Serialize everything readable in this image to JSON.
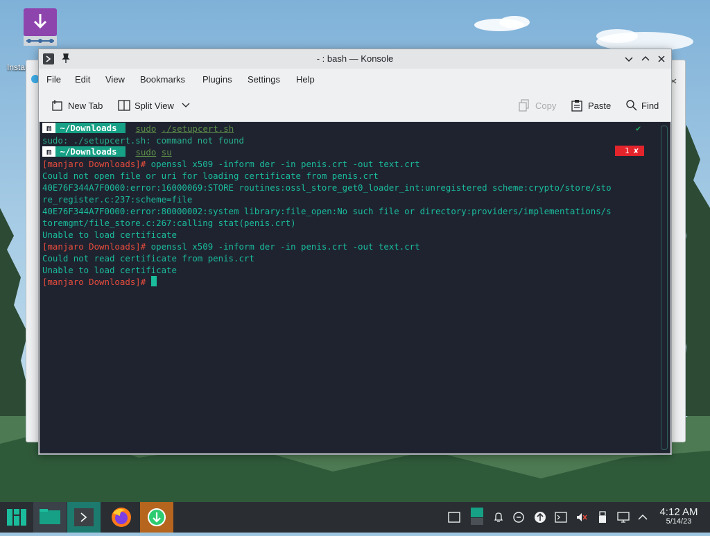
{
  "desktop": {
    "icon_label": "Installer"
  },
  "window": {
    "title": "- : bash — Konsole"
  },
  "menu": [
    "File",
    "Edit",
    "View",
    "Bookmarks",
    "Plugins",
    "Settings",
    "Help"
  ],
  "toolbar": {
    "new_tab": "New Tab",
    "split_view": "Split View",
    "copy": "Copy",
    "paste": "Paste",
    "find": "Find"
  },
  "terminal": {
    "prompt_logo": "m",
    "prompt_dir": "~/Downloads",
    "line1_cmd_sudo": "sudo",
    "line1_cmd_arg": "./setupcert.sh",
    "line2": "sudo: ./setupcert.sh: command not found",
    "line3_cmd_sudo": "sudo",
    "line3_cmd_arg": "su",
    "root_prompt": "[manjaro Downloads]#",
    "cmd1": " openssl x509 -inform der -in penis.crt -out text.crt",
    "out1": "Could not open file or uri for loading certificate from penis.crt",
    "out2": "40E76F344A7F0000:error:16000069:STORE routines:ossl_store_get0_loader_int:unregistered scheme:crypto/store/sto",
    "out3": "re_register.c:237:scheme=file",
    "out4": "40E76F344A7F0000:error:80000002:system library:file_open:No such file or directory:providers/implementations/s",
    "out5": "toremgmt/file_store.c:267:calling stat(penis.crt)",
    "out6": "Unable to load certificate",
    "cmd2": " openssl x509 -inform der -in penis.crt -out text.crt",
    "out7": "Could not read certificate from penis.crt",
    "out8": "Unable to load certificate",
    "error_badge": "1 ✘",
    "ok_mark": "✔"
  },
  "clock": {
    "time": "4:12 AM",
    "date": "5/14/23"
  },
  "colors": {
    "terminal_bg": "#1f2330",
    "terminal_fg": "#1abc9c",
    "root_prompt": "#e74c3c",
    "taskbar": "#2a2e32"
  },
  "icons": {
    "taskbar": [
      "manjaro-menu-icon",
      "file-manager-icon",
      "konsole-icon",
      "firefox-icon",
      "installer-icon"
    ],
    "tray": [
      "window-icon",
      "display-icon",
      "notifications-icon",
      "kde-connect-icon",
      "updates-icon",
      "terminal-icon",
      "mute-icon",
      "usb-icon",
      "network-icon",
      "expand-tray-icon"
    ]
  }
}
